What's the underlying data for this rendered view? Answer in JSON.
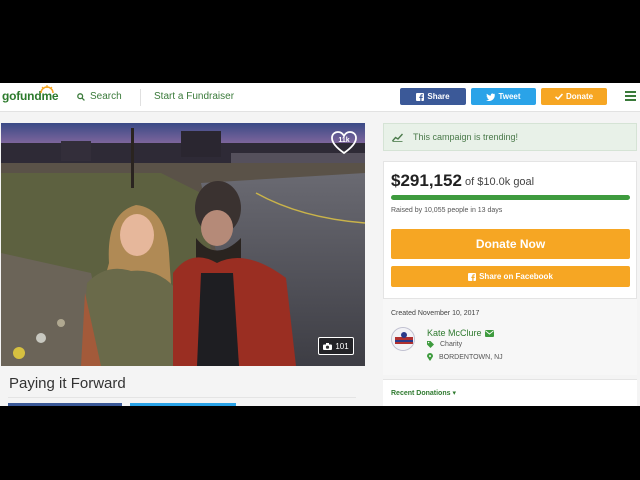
{
  "header": {
    "logo": "gofundme",
    "search_label": "Search",
    "start_label": "Start a Fundraiser",
    "share_label": "Share",
    "tweet_label": "Tweet",
    "donate_label": "Donate"
  },
  "campaign": {
    "heart_count": "11k",
    "photo_count": "101",
    "title": "Paying it Forward"
  },
  "sidebar": {
    "trending_text": "This campaign is trending!",
    "amount_raised": "$291,152",
    "goal_text": "of $10.0k goal",
    "progress_fraction": 1.0,
    "raised_by": "Raised by 10,055 people in 13 days",
    "donate_now_label": "Donate Now",
    "share_facebook_label": "Share on Facebook",
    "created": "Created November 10, 2017",
    "organizer_name": "Kate McClure",
    "category": "Charity",
    "location": "BORDENTOWN, NJ",
    "recent_donations_label": "Recent Donations"
  },
  "colors": {
    "brand_green": "#2c7a2c",
    "facebook_blue": "#3b5998",
    "twitter_blue": "#2aa3e8",
    "donate_orange": "#f6a623",
    "progress_green": "#3e9b3e"
  }
}
